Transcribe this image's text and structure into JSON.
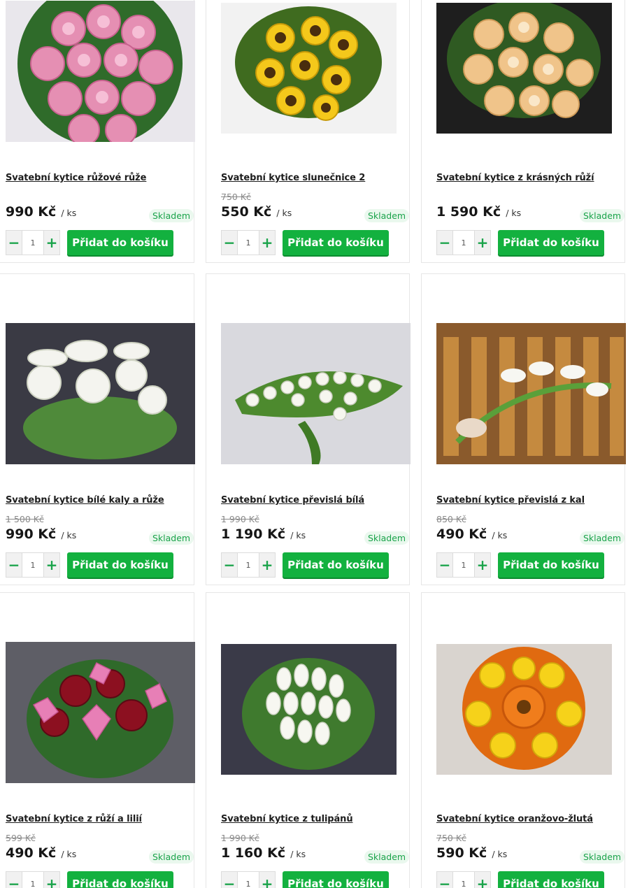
{
  "cart_button_label": "Přidat do košíku",
  "products": [
    {
      "name": "Svatební kytice růžové růže",
      "old_price": "",
      "price": "990 Kč",
      "unit": "/ ks",
      "stock": "Skladem",
      "qty": "1",
      "image": "pink-roses-bouquet"
    },
    {
      "name": "Svatební kytice slunečnice 2",
      "old_price": "750 Kč",
      "price": "550 Kč",
      "unit": "/ ks",
      "stock": "Skladem",
      "qty": "1",
      "image": "sunflower-bouquet"
    },
    {
      "name": "Svatební kytice z krásných růží",
      "old_price": "",
      "price": "1 590 Kč",
      "unit": "/ ks",
      "stock": "Skladem",
      "qty": "1",
      "image": "peach-roses-bouquet"
    },
    {
      "name": "Svatební kytice bílé kaly a růže",
      "old_price": "1 500 Kč",
      "price": "990 Kč",
      "unit": "/ ks",
      "stock": "Skladem",
      "qty": "1",
      "image": "white-calla-rose-bouquet"
    },
    {
      "name": "Svatební kytice převislá bílá",
      "old_price": "1 990 Kč",
      "price": "1 190 Kč",
      "unit": "/ ks",
      "stock": "Skladem",
      "qty": "1",
      "image": "white-cascade-bouquet"
    },
    {
      "name": "Svatební kytice převislá z kal",
      "old_price": "850 Kč",
      "price": "490 Kč",
      "unit": "/ ks",
      "stock": "Skladem",
      "qty": "1",
      "image": "calla-cascade-bouquet"
    },
    {
      "name": "Svatební kytice z růží a lilií",
      "old_price": "599 Kč",
      "price": "490 Kč",
      "unit": "/ ks",
      "stock": "Skladem",
      "qty": "1",
      "image": "rose-lily-bouquet"
    },
    {
      "name": "Svatební kytice z tulipánů",
      "old_price": "1 990 Kč",
      "price": "1 160 Kč",
      "unit": "/ ks",
      "stock": "Skladem",
      "qty": "1",
      "image": "white-tulip-bouquet"
    },
    {
      "name": "Svatební kytice oranžovo-žlutá",
      "old_price": "750 Kč",
      "price": "590 Kč",
      "unit": "/ ks",
      "stock": "Skladem",
      "qty": "1",
      "image": "orange-yellow-bouquet"
    }
  ],
  "colors": {
    "accent": "#13b13f",
    "stock_bg": "#eaf8ee",
    "stock_text": "#1aa34a"
  }
}
